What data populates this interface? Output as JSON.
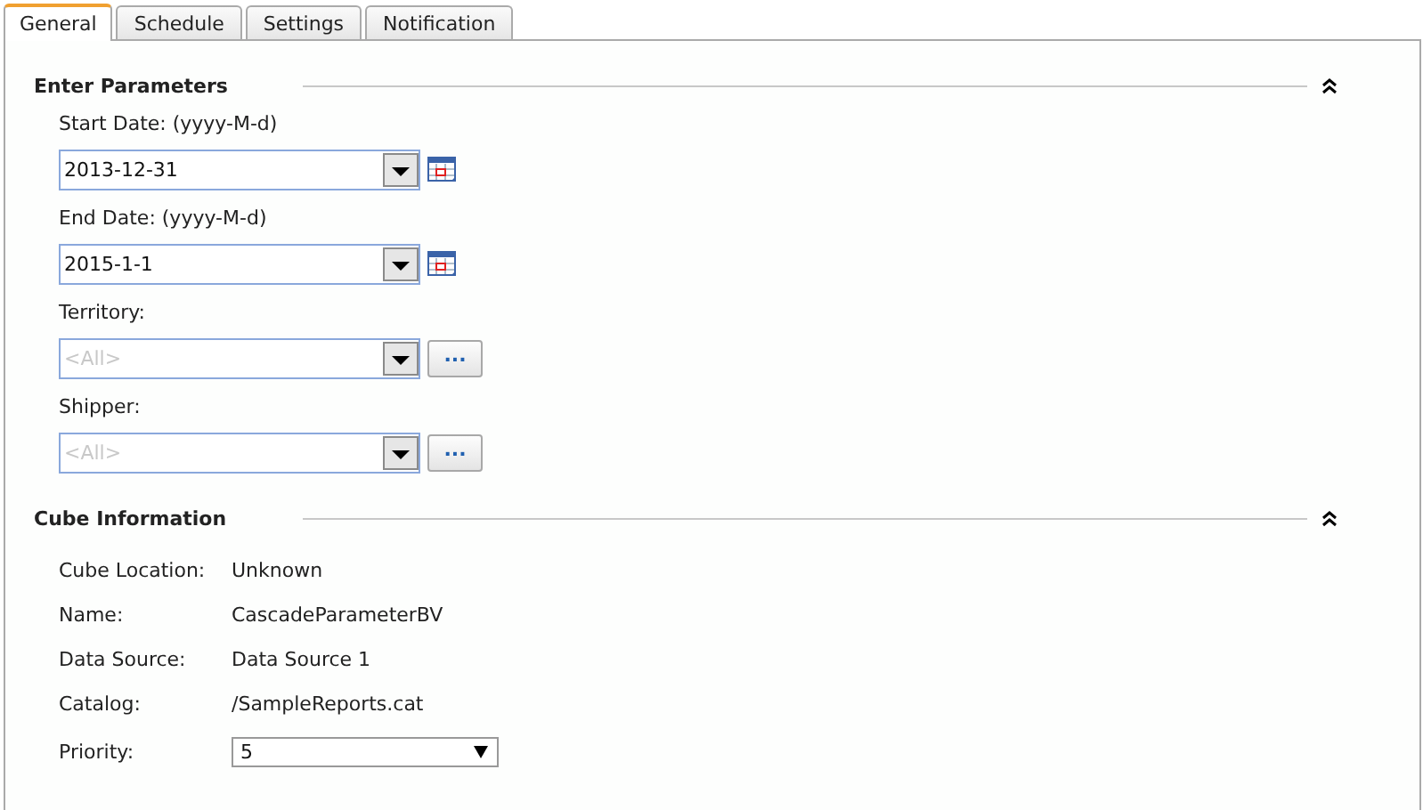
{
  "tabs": [
    {
      "label": "General",
      "selected": true
    },
    {
      "label": "Schedule",
      "selected": false
    },
    {
      "label": "Settings",
      "selected": false
    },
    {
      "label": "Notification",
      "selected": false
    }
  ],
  "parameters_section": {
    "title": "Enter Parameters",
    "expanded": true,
    "parameters": [
      {
        "kind": "date",
        "label": "Start Date: (yyyy-M-d)",
        "value": "2013-12-31"
      },
      {
        "kind": "date",
        "label": "End Date: (yyyy-M-d)",
        "value": "2015-1-1"
      },
      {
        "kind": "multi",
        "label": "Territory:",
        "placeholder": "<All>",
        "button": "..."
      },
      {
        "kind": "multi",
        "label": "Shipper:",
        "placeholder": "<All>",
        "button": "..."
      }
    ]
  },
  "cube_section": {
    "title": "Cube Information",
    "expanded": true,
    "rows": [
      {
        "label": "Cube Location:",
        "value": "Unknown"
      },
      {
        "label": "Name:",
        "value": "CascadeParameterBV"
      },
      {
        "label": "Data Source:",
        "value": "Data Source 1"
      },
      {
        "label": "Catalog:",
        "value": "/SampleReports.cat"
      }
    ],
    "priority": {
      "label": "Priority:",
      "value": "5"
    }
  }
}
